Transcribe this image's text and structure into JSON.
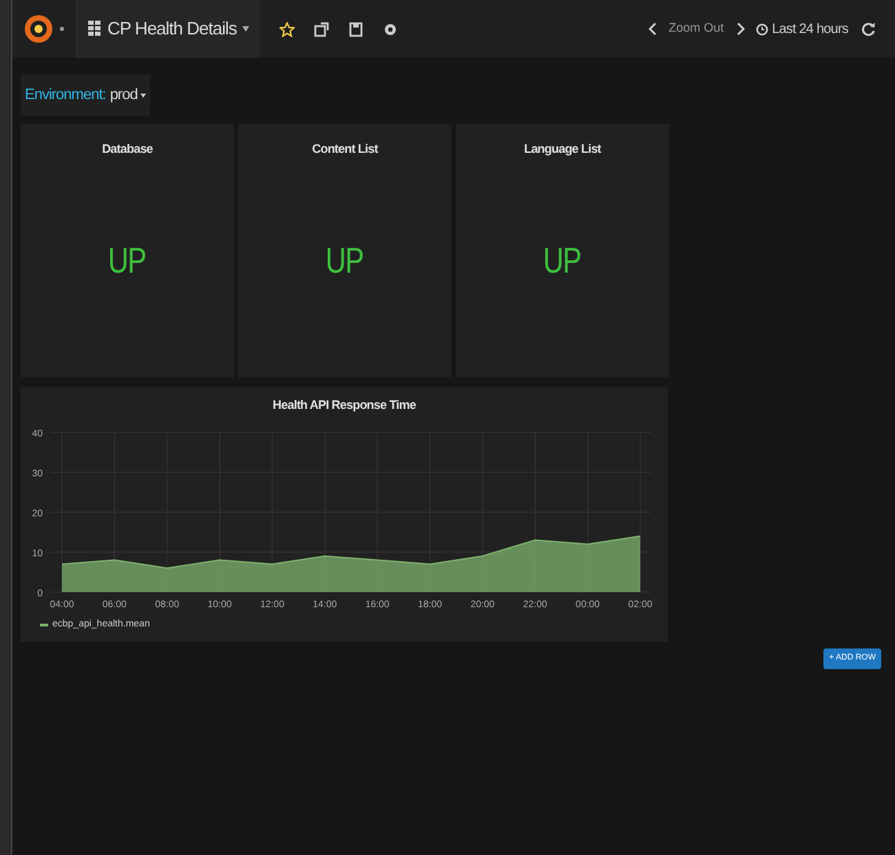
{
  "navbar": {
    "dashboard_title": "CP Health Details",
    "starred": true,
    "zoom_out": "Zoom Out",
    "time_range": "Last 24 hours"
  },
  "templating": {
    "label": "Environment:",
    "value": "prod"
  },
  "status_panels": [
    {
      "title": "Database",
      "value": "UP"
    },
    {
      "title": "Content List",
      "value": "UP"
    },
    {
      "title": "Language List",
      "value": "UP"
    }
  ],
  "graph_panel": {
    "title": "Health API Response Time",
    "chart_data": {
      "type": "area",
      "x": [
        "04:00",
        "06:00",
        "08:00",
        "10:00",
        "12:00",
        "14:00",
        "16:00",
        "18:00",
        "20:00",
        "22:00",
        "00:00",
        "02:00"
      ],
      "grid": true,
      "yticks": [
        0,
        10,
        20,
        30,
        40
      ],
      "ylim": [
        0,
        40
      ],
      "series": [
        {
          "name": "ecbp_api_health.mean",
          "color": "#7eb26d",
          "values": [
            7,
            8,
            6,
            8,
            7,
            9,
            8,
            7,
            9,
            13,
            12,
            14
          ]
        }
      ]
    }
  },
  "add_row_button": "+ ADD ROW"
}
